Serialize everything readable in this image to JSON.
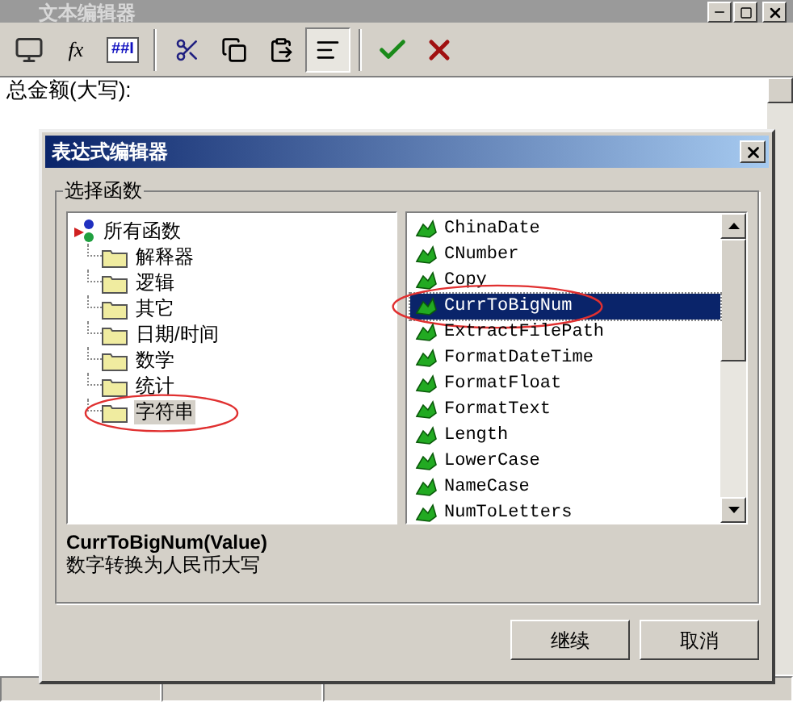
{
  "window": {
    "title": "文本编辑器"
  },
  "toolbar": [
    {
      "kind": "insert",
      "pressed": false
    },
    {
      "kind": "function",
      "label": "fx",
      "pressed": false
    },
    {
      "kind": "field",
      "label": "##I",
      "pressed": false
    },
    {
      "kind": "cut",
      "pressed": false
    },
    {
      "kind": "copy",
      "pressed": false
    },
    {
      "kind": "paste",
      "pressed": false
    },
    {
      "kind": "align",
      "pressed": true
    },
    {
      "kind": "ok",
      "pressed": false
    },
    {
      "kind": "cancel",
      "pressed": false
    }
  ],
  "editor": {
    "text": "总金额(大写):"
  },
  "dialog": {
    "title": "表达式编辑器",
    "group_label": "选择函数",
    "tree": {
      "label": "所有函数",
      "children": [
        {
          "label": "解释器",
          "selected": false,
          "circled": false
        },
        {
          "label": "逻辑",
          "selected": false,
          "circled": false
        },
        {
          "label": "其它",
          "selected": false,
          "circled": false
        },
        {
          "label": "日期/时间",
          "selected": false,
          "circled": false
        },
        {
          "label": "数学",
          "selected": false,
          "circled": false
        },
        {
          "label": "统计",
          "selected": false,
          "circled": false
        },
        {
          "label": "字符串",
          "selected": true,
          "circled": true
        }
      ]
    },
    "functions": [
      {
        "name": "ChinaDate",
        "selected": false,
        "circled": false
      },
      {
        "name": "CNumber",
        "selected": false,
        "circled": false
      },
      {
        "name": "Copy",
        "selected": false,
        "circled": false
      },
      {
        "name": "CurrToBigNum",
        "selected": true,
        "circled": true
      },
      {
        "name": "ExtractFilePath",
        "selected": false,
        "circled": false
      },
      {
        "name": "FormatDateTime",
        "selected": false,
        "circled": false
      },
      {
        "name": "FormatFloat",
        "selected": false,
        "circled": false
      },
      {
        "name": "FormatText",
        "selected": false,
        "circled": false
      },
      {
        "name": "Length",
        "selected": false,
        "circled": false
      },
      {
        "name": "LowerCase",
        "selected": false,
        "circled": false
      },
      {
        "name": "NameCase",
        "selected": false,
        "circled": false
      },
      {
        "name": "NumToLetters",
        "selected": false,
        "circled": false
      }
    ],
    "signature": "CurrToBigNum(Value)",
    "description": "数字转换为人民币大写",
    "buttons": [
      "继续",
      "取消"
    ]
  }
}
